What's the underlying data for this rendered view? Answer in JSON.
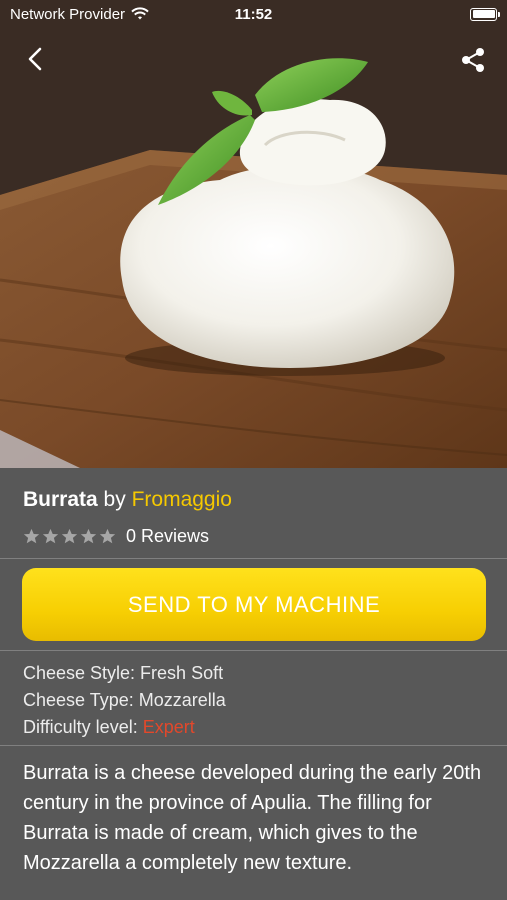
{
  "status_bar": {
    "carrier": "Network Provider",
    "time": "11:52"
  },
  "nav": {
    "back_icon": "chevron-left-icon",
    "share_icon": "share-icon"
  },
  "hero": {
    "image_alt": "burrata-photo"
  },
  "product": {
    "name": "Burrata",
    "by": "by",
    "brand": "Fromaggio",
    "rating": 0,
    "rating_max": 5,
    "reviews_label": "0 Reviews"
  },
  "actions": {
    "send_label": "SEND TO MY MACHINE"
  },
  "specs": {
    "style": "Cheese Style: Fresh Soft",
    "type": "Cheese Type: Mozzarella",
    "difficulty_label": "Difficulty level: ",
    "difficulty_value": "Expert"
  },
  "description": "Burrata is a cheese developed during the early 20th century in the province of Apulia. The filling for Burrata is made of cream, which gives to the Mozzarella a completely new texture.",
  "colors": {
    "accent_yellow": "#f6c900",
    "expert_red": "#e2482b",
    "panel_bg": "#585858"
  }
}
